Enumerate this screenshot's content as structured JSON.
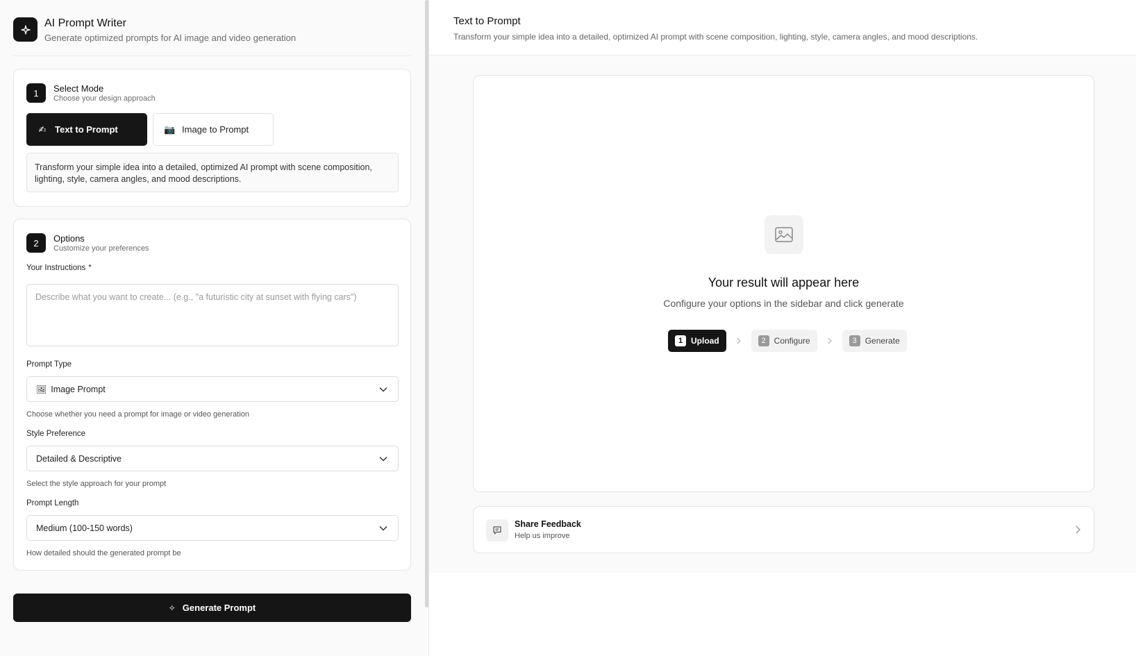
{
  "app": {
    "title": "AI Prompt Writer",
    "subtitle": "Generate optimized prompts for AI image and video generation",
    "logo_icon": "sparkle-icon"
  },
  "mode_section": {
    "step": "1",
    "title": "Select Mode",
    "subtitle": "Choose your design approach",
    "modes": [
      {
        "icon": "✍",
        "label": "Text to Prompt",
        "active": true
      },
      {
        "icon": "📷",
        "label": "Image to Prompt",
        "active": false
      }
    ],
    "description": "Transform your simple idea into a detailed, optimized AI prompt with scene composition, lighting, style, camera angles, and mood descriptions."
  },
  "options_section": {
    "step": "2",
    "title": "Options",
    "subtitle": "Customize your preferences",
    "instructions_label": "Your Instructions",
    "required_marker": "*",
    "instructions_placeholder": "Describe what you want to create... (e.g., \"a futuristic city at sunset with flying cars\")",
    "instructions_value": "",
    "prompt_type": {
      "label": "Prompt Type",
      "icon": "🖼",
      "value": "Image Prompt",
      "hint": "Choose whether you need a prompt for image or video generation"
    },
    "style": {
      "label": "Style Preference",
      "value": "Detailed & Descriptive",
      "hint": "Select the style approach for your prompt"
    },
    "length": {
      "label": "Prompt Length",
      "value": "Medium (100-150 words)",
      "hint": "How detailed should the generated prompt be"
    }
  },
  "generate_button": {
    "icon": "✧",
    "label": "Generate Prompt"
  },
  "main": {
    "title": "Text to Prompt",
    "subtitle": "Transform your simple idea into a detailed, optimized AI prompt with scene composition, lighting, style, camera angles, and mood descriptions.",
    "result_title": "Your result will appear here",
    "result_subtitle": "Configure your options in the sidebar and click generate",
    "steps": [
      {
        "num": "1",
        "label": "Upload",
        "active": true
      },
      {
        "num": "2",
        "label": "Configure",
        "active": false
      },
      {
        "num": "3",
        "label": "Generate",
        "active": false
      }
    ]
  },
  "feedback": {
    "title": "Share Feedback",
    "subtitle": "Help us improve"
  }
}
